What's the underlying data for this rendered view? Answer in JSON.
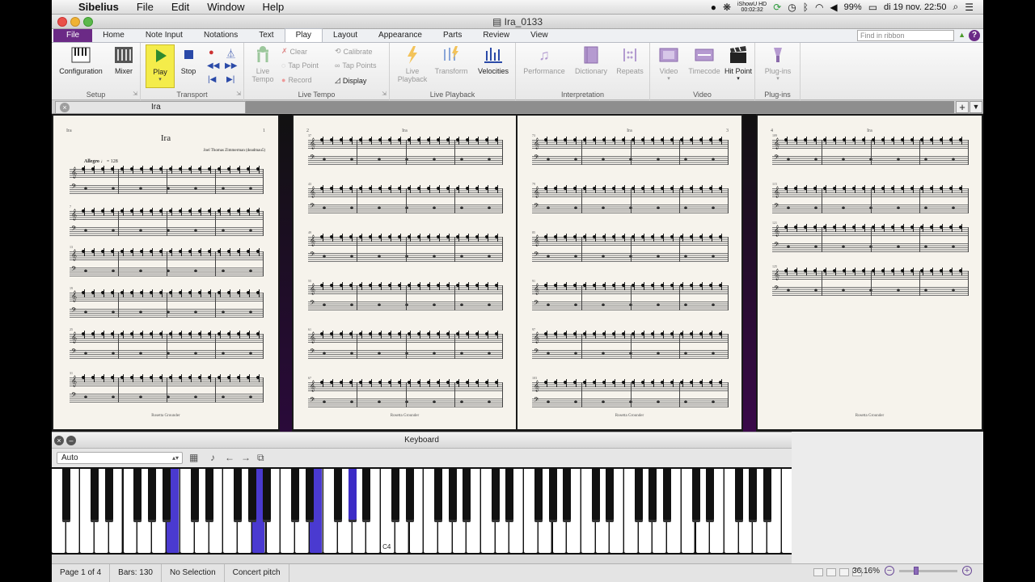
{
  "menubar": {
    "app_name": "Sibelius",
    "items": [
      "File",
      "Edit",
      "Window",
      "Help"
    ],
    "status": {
      "recorder_name": "iShowU HD",
      "recorder_time": "00:02:32",
      "battery": "99%",
      "datetime": "di 19 nov.  22:50"
    }
  },
  "window": {
    "title": "Ira_0133"
  },
  "ribbon_tabs": [
    "File",
    "Home",
    "Note Input",
    "Notations",
    "Text",
    "Play",
    "Layout",
    "Appearance",
    "Parts",
    "Review",
    "View"
  ],
  "active_tab": "Play",
  "ribbon_search_placeholder": "Find in ribbon",
  "ribbon": {
    "setup": {
      "label": "Setup",
      "configuration": "Configuration",
      "mixer": "Mixer"
    },
    "transport": {
      "label": "Transport",
      "play": "Play",
      "stop": "Stop"
    },
    "live_tempo": {
      "label": "Live Tempo",
      "live_tempo": "Live Tempo",
      "clear": "Clear",
      "tap_point": "Tap Point",
      "record": "Record",
      "calibrate": "Calibrate",
      "tap_points": "Tap Points",
      "display": "Display"
    },
    "live_playback": {
      "label": "Live Playback",
      "live_playback": "Live Playback",
      "transform": "Transform",
      "velocities": "Velocities"
    },
    "interpretation": {
      "label": "Interpretation",
      "performance": "Performance",
      "dictionary": "Dictionary",
      "repeats": "Repeats"
    },
    "video": {
      "label": "Video",
      "video": "Video",
      "timecode": "Timecode",
      "hit_point": "Hit Point"
    },
    "plugins": {
      "label": "Plug-ins",
      "plugins": "Plug-ins"
    }
  },
  "document_tab": {
    "title": "Ira"
  },
  "score": {
    "title": "Ira",
    "composer": "Joel Thomas Zimmerman (deadmau5)",
    "tempo_text": "Allegro",
    "tempo_value": "128",
    "footer": "Rosetta Grounder",
    "pages": [
      {
        "number": "1",
        "header_left": "Ira",
        "header_right": "1",
        "measure_numbers": [
          "",
          "7",
          "13",
          "19",
          "25",
          "31"
        ]
      },
      {
        "number": "2",
        "header_left": "2",
        "header_center": "Ira",
        "measure_numbers": [
          "37",
          "43",
          "49",
          "55",
          "61",
          "67"
        ]
      },
      {
        "number": "3",
        "header_center": "Ira",
        "header_right": "3",
        "measure_numbers": [
          "73",
          "79",
          "85",
          "91",
          "97",
          "103"
        ]
      },
      {
        "number": "4",
        "header_left": "4",
        "header_center": "Ira",
        "measure_numbers": [
          "109",
          "115",
          "121",
          "125"
        ]
      }
    ]
  },
  "keyboard": {
    "title": "Keyboard",
    "mode": "Auto",
    "c4_label": "C4",
    "pressed_white_keys": [
      8,
      14,
      18
    ],
    "pressed_black_keys": [
      14
    ]
  },
  "statusbar": {
    "page": "Page 1 of 4",
    "bars": "Bars: 130",
    "selection": "No Selection",
    "pitch": "Concert pitch",
    "zoom": "36.16%"
  },
  "colors": {
    "accent": "#6b2a86",
    "play_highlight": "#f4ec4a",
    "pressed_key": "#4a3ad0",
    "page_paper": "#f6f3ec"
  }
}
